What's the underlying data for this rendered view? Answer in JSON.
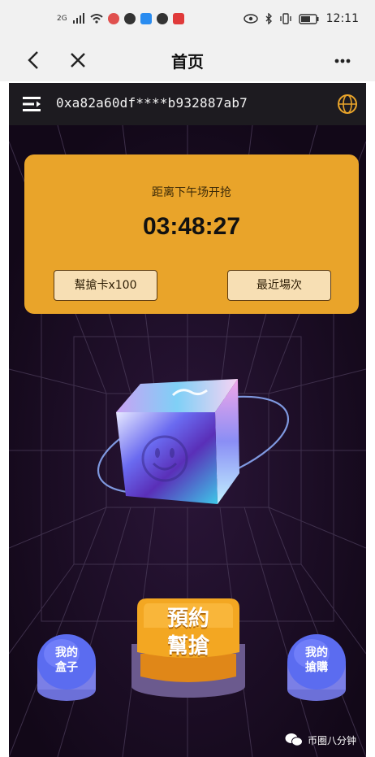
{
  "status_bar": {
    "network": "2G",
    "time": "12:11"
  },
  "title_bar": {
    "title": "首页",
    "back_icon": "back-arrow-icon",
    "close_icon": "close-icon",
    "more_icon": "more-icon"
  },
  "app": {
    "wallet_address": "0xa82a60df****b932887ab7",
    "countdown": {
      "label": "距离下午场开抢",
      "time": "03:48:27"
    },
    "buttons": {
      "grab_card": "幫搶卡x100",
      "recent_rounds": "最近場次"
    },
    "bottom": {
      "my_box_line1": "我的",
      "my_box_line2": "盒子",
      "reserve_line1": "預約",
      "reserve_line2": "幫搶",
      "my_grab_line1": "我的",
      "my_grab_line2": "搶購"
    },
    "watermark": "币圈八分钟"
  },
  "colors": {
    "card": "#e9a42a",
    "background": "#160b1f",
    "button_blue": "#5b6cf0",
    "button_orange": "#f3a722"
  }
}
